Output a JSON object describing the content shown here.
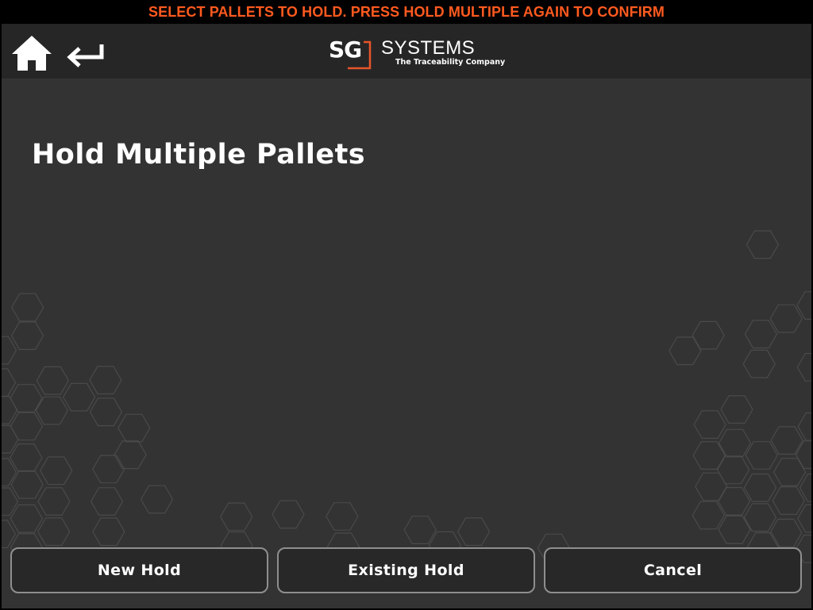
{
  "banner": {
    "message": "SELECT PALLETS TO HOLD. PRESS HOLD MULTIPLE AGAIN TO CONFIRM",
    "color": "#ff5a1f"
  },
  "header": {
    "home_icon": "home-icon",
    "back_icon": "back-arrow-icon",
    "logo": {
      "mark": "SG",
      "name": "SYSTEMS",
      "tagline": "The Traceability Company",
      "accent_color": "#e8552a"
    }
  },
  "main": {
    "title": "Hold Multiple Pallets"
  },
  "actions": {
    "new_hold": "New Hold",
    "existing_hold": "Existing Hold",
    "cancel": "Cancel"
  },
  "theme": {
    "background": "#333333",
    "header_background": "#262626",
    "button_border": "#8f8f8f"
  }
}
